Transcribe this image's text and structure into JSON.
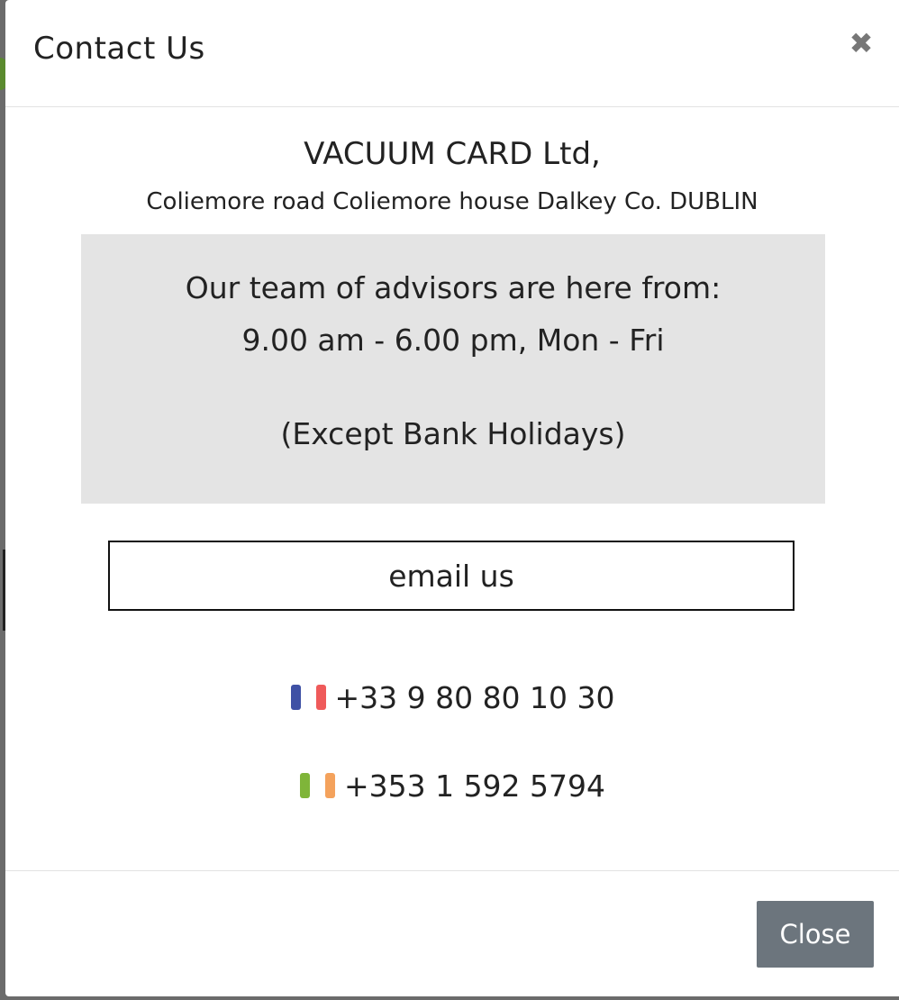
{
  "modal": {
    "title": "Contact Us",
    "close_icon": "close-icon"
  },
  "company": {
    "name": "VACUUM CARD Ltd,",
    "address": "Coliemore road Coliemore house Dalkey Co. DUBLIN"
  },
  "hours": {
    "intro": "Our team of advisors are here from:",
    "times": "9.00 am - 6.00 pm, Mon - Fri",
    "note": "(Except Bank Holidays)",
    "box_color": "#e4e4e4"
  },
  "email_button": {
    "label": "email us"
  },
  "phones": [
    {
      "flag": "france-flag-icon",
      "number": "+33 9 80 80 10 30",
      "flag_colors": [
        "#3f51a5",
        "#ffffff",
        "#ef5a5a"
      ]
    },
    {
      "flag": "ireland-flag-icon",
      "number": "+353 1 592 5794",
      "flag_colors": [
        "#7fb539",
        "#ffffff",
        "#f4a25c"
      ]
    }
  ],
  "footer": {
    "close_label": "Close",
    "close_color": "#6c757d"
  }
}
